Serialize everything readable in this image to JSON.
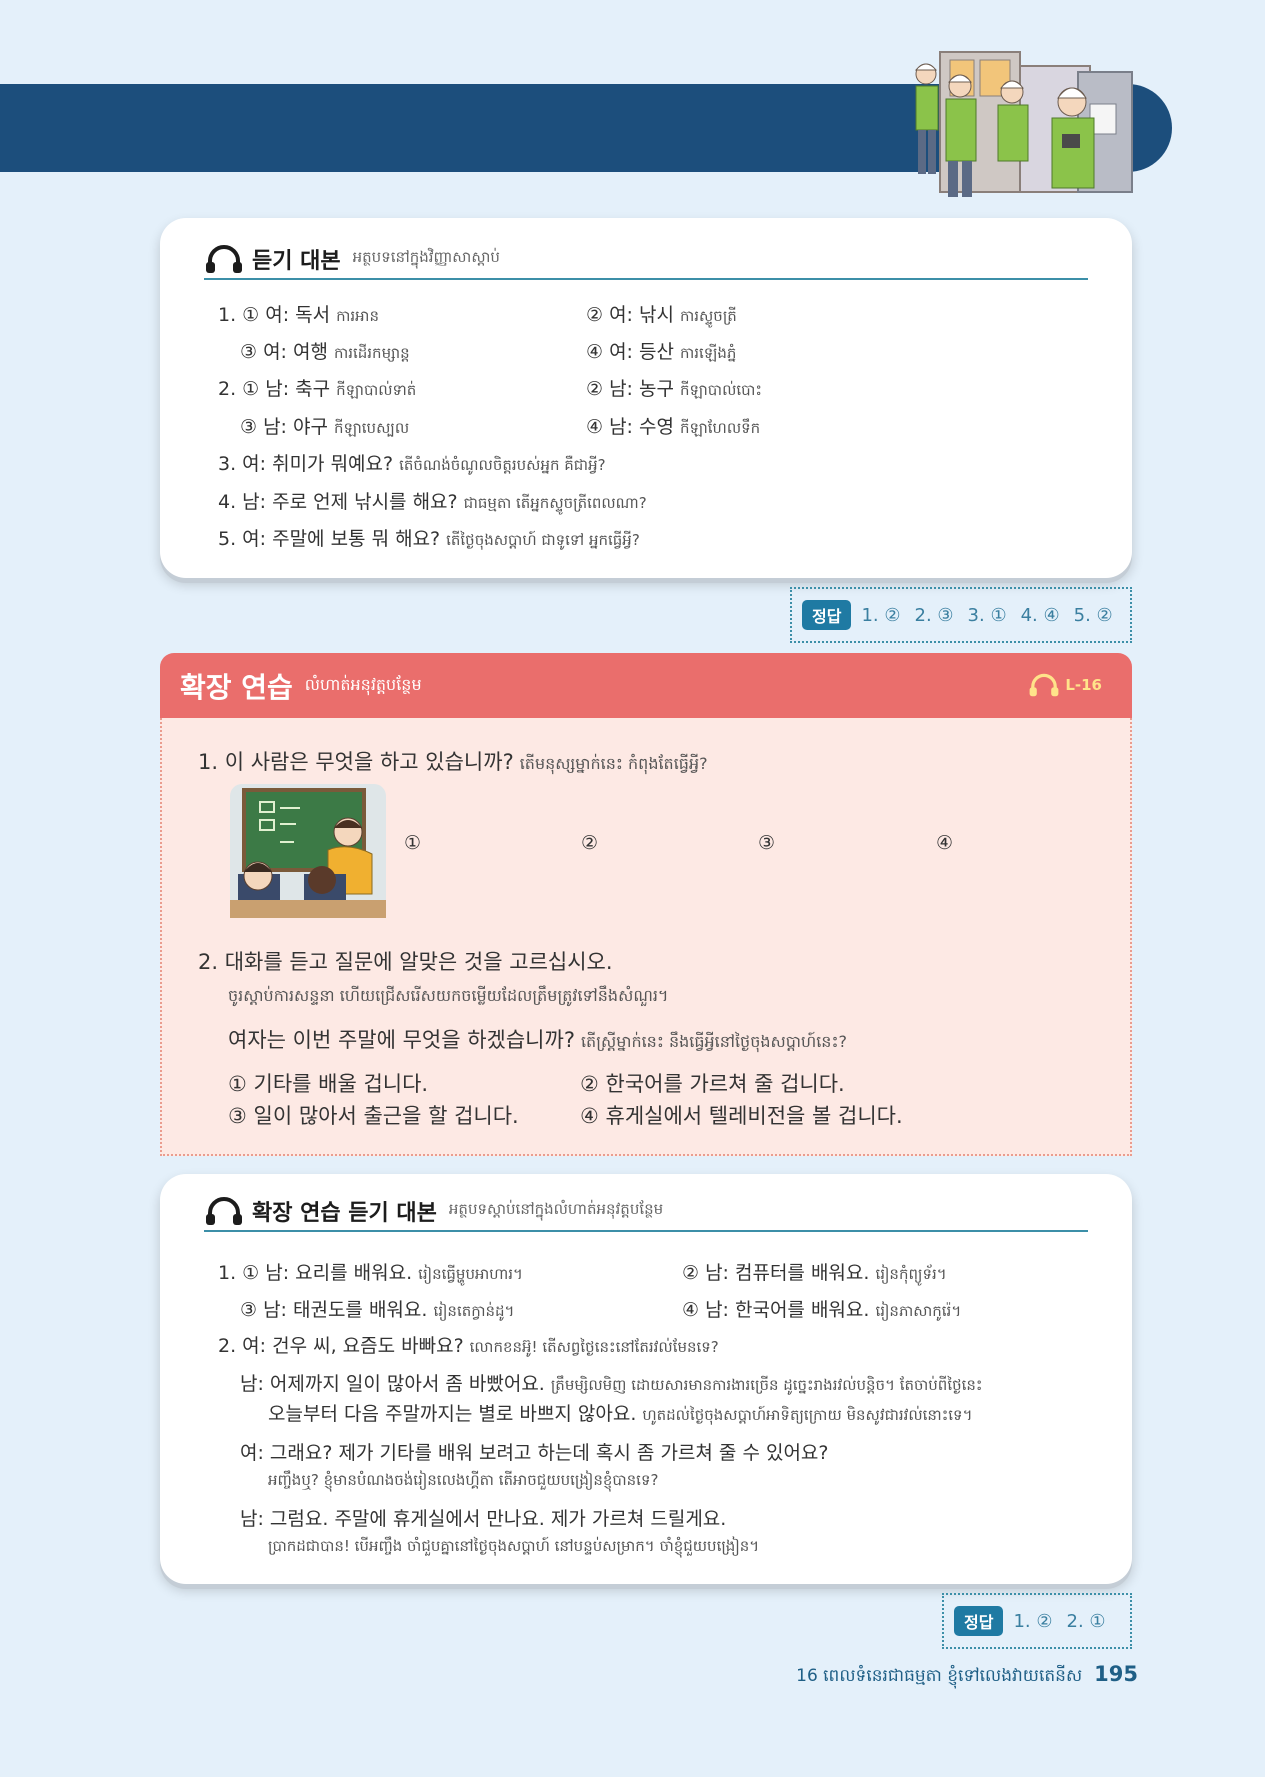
{
  "colors": {
    "band": "#1c4e7c",
    "accent": "#3c8fa8",
    "extension_header": "#ea6e6c",
    "extension_body": "#fde9e4"
  },
  "script_card": {
    "title": "듣기 대본",
    "subtitle": "អត្ថបទនៅក្នុងវិញ្ញាសាស្ដាប់",
    "lines": [
      {
        "text": "1. ① 여: 독서",
        "kh": "ការអាន"
      },
      {
        "text": "② 여: 낚시",
        "kh": "ការស្ទូចត្រី"
      },
      {
        "text": "③ 여: 여행",
        "kh": "ការដើរកម្សាន្ដ"
      },
      {
        "text": "④ 여: 등산",
        "kh": "ការឡើងភ្នំ"
      },
      {
        "text": "2. ① 남: 축구",
        "kh": "កីឡាបាល់ទាត់"
      },
      {
        "text": "② 남: 농구",
        "kh": "កីឡាបាល់បោះ"
      },
      {
        "text": "③ 남: 야구",
        "kh": "កីឡាបេស្បល"
      },
      {
        "text": "④ 남: 수영",
        "kh": "កីឡាហែលទឹក"
      },
      {
        "text": "3. 여: 취미가 뭐예요?",
        "kh": "តើចំណង់ចំណូលចិត្តរបស់អ្នក គឺជាអ្វី?"
      },
      {
        "text": "4. 남: 주로 언제 낚시를 해요?",
        "kh": "ជាធម្មតា តើអ្នកស្ទូចត្រីពេលណា?"
      },
      {
        "text": "5. 여: 주말에 보통 뭐 해요?",
        "kh": "តើថ្ងៃចុងសប្ដាហ៍ ជាទូទៅ អ្នកធ្វើអ្វី?"
      }
    ]
  },
  "answer1": {
    "label": "정답",
    "answers": [
      "1. ②",
      "2. ③",
      "3. ①",
      "4. ④",
      "5. ②"
    ]
  },
  "extension": {
    "title": "확장 연습",
    "subtitle": "លំហាត់អនុវត្តបន្ថែម",
    "audio_label": "L-16",
    "q1": {
      "text": "1.  이 사람은 무엇을 하고 있습니까?",
      "kh": "តើមនុស្សម្នាក់នេះ កំពុងតែធ្វើអ្វី?",
      "options": [
        "①",
        "②",
        "③",
        "④"
      ]
    },
    "q2": {
      "text": "2.  대화를 듣고 질문에 알맞은 것을 고르십시오.",
      "kh_instruction": "ចូរស្ដាប់ការសន្ទនា ហើយជ្រើសរើសយកចម្លើយដែលត្រឹមត្រូវទៅនឹងសំណួរ។",
      "question": "여자는 이번 주말에 무엇을 하겠습니까?",
      "question_kh": "តើស្ត្រីម្នាក់នេះ នឹងធ្វើអ្វីនៅថ្ងៃចុងសប្ដាហ៍នេះ?",
      "choices": [
        "① 기타를 배울 겁니다.",
        "② 한국어를 가르쳐 줄 겁니다.",
        "③ 일이 많아서 출근을 할 겁니다.",
        "④ 휴게실에서 텔레비전을 볼 겁니다."
      ]
    }
  },
  "ext_script_card": {
    "title": "확장 연습 듣기 대본",
    "subtitle": "អត្ថបទស្ដាប់នៅក្នុងលំហាត់អនុវត្តបន្ថែម",
    "lines": [
      {
        "text": "1. ① 남: 요리를 배워요.",
        "kh": "រៀនធ្វើម្ហូបអាហារ។"
      },
      {
        "text": "② 남: 컴퓨터를 배워요.",
        "kh": "រៀនកុំព្យូទ័រ។"
      },
      {
        "text": "③ 남: 태권도를 배워요.",
        "kh": "រៀនតេក្វាន់ដូ។"
      },
      {
        "text": "④ 남: 한국어를 배워요.",
        "kh": "រៀនភាសាកូរ៉េ។"
      },
      {
        "text": "2. 여: 건우 씨, 요즘도 바빠요?",
        "kh": "លោកខនអ៊ូ! តើសព្វថ្ងៃនេះនៅតែរវល់មែនទេ?"
      },
      {
        "text": "남: 어제까지 일이 많아서 좀 바빴어요.",
        "kh": "ត្រឹមម្សិលមិញ ដោយសារមានការងារច្រើន ដូច្នេះរាងរវល់បន្តិច។ តែចាប់ពីថ្ងៃនេះ"
      },
      {
        "text": "오늘부터 다음 주말까지는 별로 바쁘지 않아요.",
        "kh": "ហូតដល់ថ្ងៃចុងសប្ដាហ៍អាទិត្យក្រោយ មិនសូវជារវល់នោះទេ។"
      },
      {
        "text": "여: 그래요? 제가 기타를 배워 보려고 하는데 혹시 좀 가르쳐 줄 수 있어요?",
        "kh": ""
      },
      {
        "text": "",
        "kh": "អញ្ចឹងឬ? ខ្ញុំមានបំណងចង់រៀនលេងហ្គីតា តើអាចជួយបង្រៀនខ្ញុំបានទេ?"
      },
      {
        "text": "남: 그럼요. 주말에 휴게실에서 만나요. 제가 가르쳐 드릴게요.",
        "kh": ""
      },
      {
        "text": "",
        "kh": "ប្រាកដជាបាន! បើអញ្ចឹង ចាំជួបគ្នានៅថ្ងៃចុងសប្ដាហ៍ នៅបន្ទប់សម្រាក។ ចាំខ្ញុំជួយបង្រៀន។"
      }
    ]
  },
  "answer2": {
    "label": "정답",
    "answers": [
      "1. ②",
      "2. ①"
    ]
  },
  "footer": {
    "chapter": "16 ពេលទំនេរជាធម្មតា ខ្ញុំទៅលេងវាយតេនីស",
    "page": "195"
  }
}
